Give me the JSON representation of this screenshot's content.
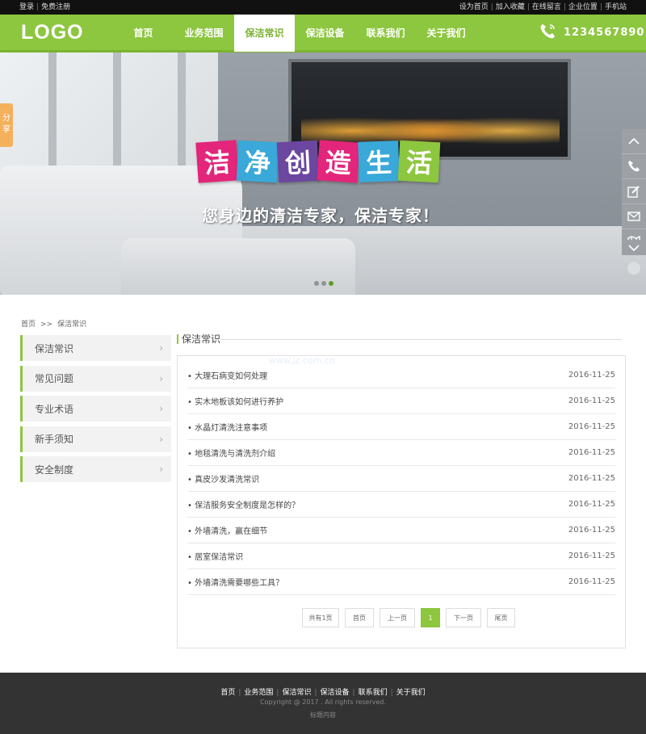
{
  "topbar": {
    "left": [
      "登录",
      "免费注册"
    ],
    "right": [
      "设为首页",
      "加入收藏",
      "在线留言",
      "企业位置",
      "手机站"
    ]
  },
  "header": {
    "logo": "LOGO",
    "nav": [
      "首页",
      "业务范围",
      "保洁常识",
      "保洁设备",
      "联系我们",
      "关于我们"
    ],
    "active_nav": "保洁常识",
    "phone": "1234567890",
    "brand_color": "#8dc63f"
  },
  "banner": {
    "title_chars": [
      "洁",
      "净",
      "创",
      "造",
      "生",
      "活"
    ],
    "title_colors": [
      "#e3257b",
      "#3aa8d8",
      "#6b47a0",
      "#e3257b",
      "#3aa8d8",
      "#8dc63f"
    ],
    "slogan": "您身边的清洁专家，保洁专家！",
    "share_label": "分享",
    "slide_count": 3,
    "active_slide": 3
  },
  "breadcrumb": {
    "home": "首页",
    "separator": ">>",
    "current": "保洁常识"
  },
  "sidebar": {
    "items": [
      "保洁常识",
      "常见问题",
      "专业术语",
      "新手须知",
      "安全制度"
    ],
    "arrow": "›"
  },
  "section": {
    "title": "保洁常识"
  },
  "watermark": "www.jz.com.cn",
  "news": [
    {
      "title": "• 大理石病变如何处理",
      "date": "2016-11-25"
    },
    {
      "title": "• 实木地板该如何进行养护",
      "date": "2016-11-25"
    },
    {
      "title": "• 水晶灯清洗注意事项",
      "date": "2016-11-25"
    },
    {
      "title": "• 地毯清洗与清洗剂介绍",
      "date": "2016-11-25"
    },
    {
      "title": "• 真皮沙发清洗常识",
      "date": "2016-11-25"
    },
    {
      "title": "• 保洁服务安全制度是怎样的？",
      "date": "2016-11-25"
    },
    {
      "title": "• 外墙清洗，赢在细节",
      "date": "2016-11-25"
    },
    {
      "title": "• 居室保洁常识",
      "date": "2016-11-25"
    },
    {
      "title": "• 外墙清洗需要哪些工具？",
      "date": "2016-11-25"
    }
  ],
  "pager": {
    "total": "共有1页",
    "first": "首页",
    "prev": "上一页",
    "current": "1",
    "next": "下一页",
    "last": "尾页"
  },
  "footer": {
    "links": [
      "首页",
      "业务范围",
      "保洁常识",
      "保洁设备",
      "联系我们",
      "关于我们"
    ],
    "copyright": "Copyright @ 2017 . All rights reserved.",
    "extra": "标题内容"
  }
}
